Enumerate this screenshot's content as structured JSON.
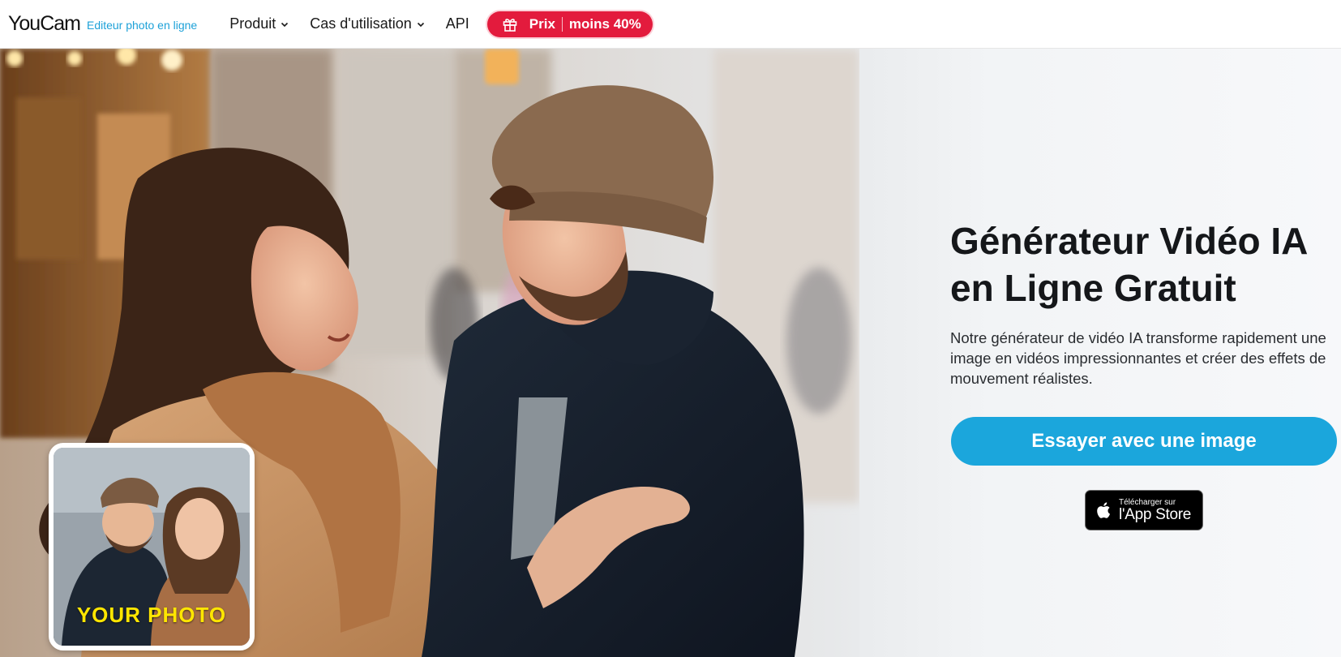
{
  "header": {
    "logo": "YouCam",
    "logo_subtitle": "Editeur photo en ligne",
    "nav": [
      {
        "label": "Produit",
        "has_dropdown": true
      },
      {
        "label": "Cas d'utilisation",
        "has_dropdown": true
      },
      {
        "label": "API",
        "has_dropdown": false
      }
    ],
    "promo": {
      "label_left": "Prix",
      "label_right": "moins 40%",
      "icon": "gift-icon",
      "color": "#e31b3d"
    }
  },
  "hero": {
    "title_line1": "Générateur Vidéo IA",
    "title_line2": "en Ligne Gratuit",
    "description": "Notre générateur de vidéo IA transforme rapidement une image en vidéos impressionnantes et créer des effets de mouvement réalistes.",
    "cta_label": "Essayer avec une image",
    "cta_color": "#1ba6dc",
    "inset_label": "YOUR PHOTO",
    "appstore": {
      "small": "Télécharger sur",
      "big": "l'App Store",
      "icon": "apple-icon"
    }
  },
  "colors": {
    "accent": "#1da1d8",
    "promo": "#e31b3d",
    "text": "#15171a"
  }
}
